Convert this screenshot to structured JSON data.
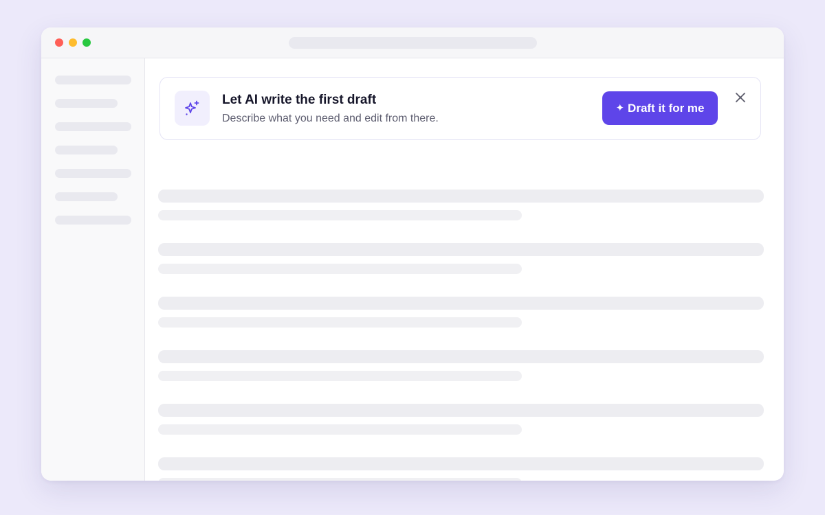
{
  "window": {
    "traffic_lights": {
      "close_color": "#FF5F57",
      "minimize_color": "#FEBC2E",
      "zoom_color": "#28C840"
    }
  },
  "banner": {
    "icon": "sparkles-icon",
    "title": "Let AI write the first draft",
    "subtitle": "Describe what you need and edit from there.",
    "button_icon": "✦",
    "button_label": "Draft it for me",
    "close_icon": "close-icon",
    "accent_color": "#5E45E9"
  }
}
